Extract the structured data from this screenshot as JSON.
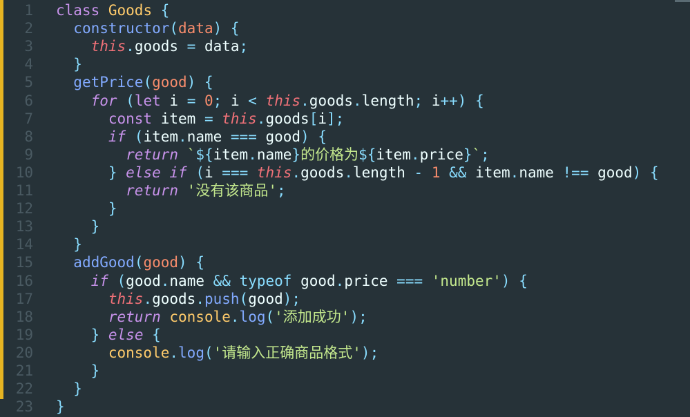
{
  "editor": {
    "colors": {
      "background": "#263238",
      "change_bar": "#e6b422",
      "line_number": "#4a5a62",
      "keyword": "#c792ea",
      "this": "#f07178",
      "class_name": "#ffcb6b",
      "function": "#82aaff",
      "parameter": "#f78c6c",
      "string": "#c3e88d",
      "operator": "#89ddff",
      "plain": "#eeffff"
    },
    "lines": [
      {
        "num": "1",
        "tokens": [
          {
            "t": "",
            "c": "sp"
          },
          {
            "t": "class",
            "c": "kw"
          },
          {
            "t": " ",
            "c": "sp"
          },
          {
            "t": "Goods",
            "c": "cls"
          },
          {
            "t": " {",
            "c": "pn"
          }
        ]
      },
      {
        "num": "2",
        "tokens": [
          {
            "t": "  ",
            "c": "sp"
          },
          {
            "t": "constructor",
            "c": "fn"
          },
          {
            "t": "(",
            "c": "pn"
          },
          {
            "t": "data",
            "c": "par"
          },
          {
            "t": ") {",
            "c": "pn"
          }
        ]
      },
      {
        "num": "3",
        "tokens": [
          {
            "t": "    ",
            "c": "sp"
          },
          {
            "t": "this",
            "c": "this"
          },
          {
            "t": ".",
            "c": "pn"
          },
          {
            "t": "goods",
            "c": "id"
          },
          {
            "t": " = ",
            "c": "op"
          },
          {
            "t": "data",
            "c": "id"
          },
          {
            "t": ";",
            "c": "pn"
          }
        ]
      },
      {
        "num": "4",
        "tokens": [
          {
            "t": "  ",
            "c": "sp"
          },
          {
            "t": "}",
            "c": "pn"
          }
        ]
      },
      {
        "num": "5",
        "tokens": [
          {
            "t": "  ",
            "c": "sp"
          },
          {
            "t": "getPrice",
            "c": "fn"
          },
          {
            "t": "(",
            "c": "pn"
          },
          {
            "t": "good",
            "c": "par"
          },
          {
            "t": ") {",
            "c": "pn"
          }
        ]
      },
      {
        "num": "6",
        "tokens": [
          {
            "t": "    ",
            "c": "sp"
          },
          {
            "t": "for",
            "c": "ctl"
          },
          {
            "t": " (",
            "c": "pn"
          },
          {
            "t": "let",
            "c": "kw"
          },
          {
            "t": " i ",
            "c": "id"
          },
          {
            "t": "=",
            "c": "op"
          },
          {
            "t": " ",
            "c": "sp"
          },
          {
            "t": "0",
            "c": "num"
          },
          {
            "t": "; ",
            "c": "pn"
          },
          {
            "t": "i ",
            "c": "id"
          },
          {
            "t": "<",
            "c": "op"
          },
          {
            "t": " ",
            "c": "sp"
          },
          {
            "t": "this",
            "c": "this"
          },
          {
            "t": ".",
            "c": "pn"
          },
          {
            "t": "goods",
            "c": "id"
          },
          {
            "t": ".",
            "c": "pn"
          },
          {
            "t": "length",
            "c": "id"
          },
          {
            "t": "; ",
            "c": "pn"
          },
          {
            "t": "i",
            "c": "id"
          },
          {
            "t": "++",
            "c": "op"
          },
          {
            "t": ") {",
            "c": "pn"
          }
        ]
      },
      {
        "num": "7",
        "tokens": [
          {
            "t": "      ",
            "c": "sp"
          },
          {
            "t": "const",
            "c": "kw"
          },
          {
            "t": " item ",
            "c": "id"
          },
          {
            "t": "=",
            "c": "op"
          },
          {
            "t": " ",
            "c": "sp"
          },
          {
            "t": "this",
            "c": "this"
          },
          {
            "t": ".",
            "c": "pn"
          },
          {
            "t": "goods",
            "c": "id"
          },
          {
            "t": "[",
            "c": "pn"
          },
          {
            "t": "i",
            "c": "id"
          },
          {
            "t": "];",
            "c": "pn"
          }
        ]
      },
      {
        "num": "8",
        "tokens": [
          {
            "t": "      ",
            "c": "sp"
          },
          {
            "t": "if",
            "c": "ctl"
          },
          {
            "t": " (",
            "c": "pn"
          },
          {
            "t": "item",
            "c": "id"
          },
          {
            "t": ".",
            "c": "pn"
          },
          {
            "t": "name ",
            "c": "id"
          },
          {
            "t": "===",
            "c": "op"
          },
          {
            "t": " good",
            "c": "id"
          },
          {
            "t": ") {",
            "c": "pn"
          }
        ]
      },
      {
        "num": "9",
        "tokens": [
          {
            "t": "        ",
            "c": "sp"
          },
          {
            "t": "return",
            "c": "ctl"
          },
          {
            "t": " ",
            "c": "sp"
          },
          {
            "t": "`",
            "c": "str"
          },
          {
            "t": "${",
            "c": "op"
          },
          {
            "t": "item",
            "c": "id"
          },
          {
            "t": ".",
            "c": "pn"
          },
          {
            "t": "name",
            "c": "id"
          },
          {
            "t": "}",
            "c": "op"
          },
          {
            "t": "的价格为",
            "c": "str"
          },
          {
            "t": "${",
            "c": "op"
          },
          {
            "t": "item",
            "c": "id"
          },
          {
            "t": ".",
            "c": "pn"
          },
          {
            "t": "price",
            "c": "id"
          },
          {
            "t": "}",
            "c": "op"
          },
          {
            "t": "`",
            "c": "str"
          },
          {
            "t": ";",
            "c": "pn"
          }
        ]
      },
      {
        "num": "10",
        "tokens": [
          {
            "t": "      ",
            "c": "sp"
          },
          {
            "t": "}",
            "c": "pn"
          },
          {
            "t": " ",
            "c": "sp"
          },
          {
            "t": "else",
            "c": "ctl"
          },
          {
            "t": " ",
            "c": "sp"
          },
          {
            "t": "if",
            "c": "ctl"
          },
          {
            "t": " (",
            "c": "pn"
          },
          {
            "t": "i ",
            "c": "id"
          },
          {
            "t": "===",
            "c": "op"
          },
          {
            "t": " ",
            "c": "sp"
          },
          {
            "t": "this",
            "c": "this"
          },
          {
            "t": ".",
            "c": "pn"
          },
          {
            "t": "goods",
            "c": "id"
          },
          {
            "t": ".",
            "c": "pn"
          },
          {
            "t": "length ",
            "c": "id"
          },
          {
            "t": "-",
            "c": "op"
          },
          {
            "t": " ",
            "c": "sp"
          },
          {
            "t": "1",
            "c": "num"
          },
          {
            "t": " ",
            "c": "sp"
          },
          {
            "t": "&&",
            "c": "op"
          },
          {
            "t": " item",
            "c": "id"
          },
          {
            "t": ".",
            "c": "pn"
          },
          {
            "t": "name ",
            "c": "id"
          },
          {
            "t": "!==",
            "c": "op"
          },
          {
            "t": " good",
            "c": "id"
          },
          {
            "t": ") {",
            "c": "pn"
          }
        ]
      },
      {
        "num": "11",
        "tokens": [
          {
            "t": "        ",
            "c": "sp"
          },
          {
            "t": "return",
            "c": "ctl"
          },
          {
            "t": " ",
            "c": "sp"
          },
          {
            "t": "'没有该商品'",
            "c": "str"
          },
          {
            "t": ";",
            "c": "pn"
          }
        ]
      },
      {
        "num": "12",
        "tokens": [
          {
            "t": "      ",
            "c": "sp"
          },
          {
            "t": "}",
            "c": "pn"
          }
        ]
      },
      {
        "num": "13",
        "tokens": [
          {
            "t": "    ",
            "c": "sp"
          },
          {
            "t": "}",
            "c": "pn"
          }
        ]
      },
      {
        "num": "14",
        "tokens": [
          {
            "t": "  ",
            "c": "sp"
          },
          {
            "t": "}",
            "c": "pn"
          }
        ]
      },
      {
        "num": "15",
        "tokens": [
          {
            "t": "  ",
            "c": "sp"
          },
          {
            "t": "addGood",
            "c": "fn"
          },
          {
            "t": "(",
            "c": "pn"
          },
          {
            "t": "good",
            "c": "par"
          },
          {
            "t": ") {",
            "c": "pn"
          }
        ]
      },
      {
        "num": "16",
        "tokens": [
          {
            "t": "    ",
            "c": "sp"
          },
          {
            "t": "if",
            "c": "ctl"
          },
          {
            "t": " (",
            "c": "pn"
          },
          {
            "t": "good",
            "c": "id"
          },
          {
            "t": ".",
            "c": "pn"
          },
          {
            "t": "name ",
            "c": "id"
          },
          {
            "t": "&&",
            "c": "op"
          },
          {
            "t": " ",
            "c": "sp"
          },
          {
            "t": "typeof",
            "c": "type"
          },
          {
            "t": " good",
            "c": "id"
          },
          {
            "t": ".",
            "c": "pn"
          },
          {
            "t": "price ",
            "c": "id"
          },
          {
            "t": "===",
            "c": "op"
          },
          {
            "t": " ",
            "c": "sp"
          },
          {
            "t": "'number'",
            "c": "str"
          },
          {
            "t": ") {",
            "c": "pn"
          }
        ]
      },
      {
        "num": "17",
        "tokens": [
          {
            "t": "      ",
            "c": "sp"
          },
          {
            "t": "this",
            "c": "this"
          },
          {
            "t": ".",
            "c": "pn"
          },
          {
            "t": "goods",
            "c": "id"
          },
          {
            "t": ".",
            "c": "pn"
          },
          {
            "t": "push",
            "c": "fn"
          },
          {
            "t": "(",
            "c": "pn"
          },
          {
            "t": "good",
            "c": "id"
          },
          {
            "t": ");",
            "c": "pn"
          }
        ]
      },
      {
        "num": "18",
        "tokens": [
          {
            "t": "      ",
            "c": "sp"
          },
          {
            "t": "return",
            "c": "ctl"
          },
          {
            "t": " ",
            "c": "sp"
          },
          {
            "t": "console",
            "c": "cons"
          },
          {
            "t": ".",
            "c": "pn"
          },
          {
            "t": "log",
            "c": "fn"
          },
          {
            "t": "(",
            "c": "pn"
          },
          {
            "t": "'添加成功'",
            "c": "str"
          },
          {
            "t": ");",
            "c": "pn"
          }
        ]
      },
      {
        "num": "19",
        "tokens": [
          {
            "t": "    ",
            "c": "sp"
          },
          {
            "t": "}",
            "c": "pn"
          },
          {
            "t": " ",
            "c": "sp"
          },
          {
            "t": "else",
            "c": "ctl"
          },
          {
            "t": " {",
            "c": "pn"
          }
        ]
      },
      {
        "num": "20",
        "tokens": [
          {
            "t": "      ",
            "c": "sp"
          },
          {
            "t": "console",
            "c": "cons"
          },
          {
            "t": ".",
            "c": "pn"
          },
          {
            "t": "log",
            "c": "fn"
          },
          {
            "t": "(",
            "c": "pn"
          },
          {
            "t": "'请输入正确商品格式'",
            "c": "str"
          },
          {
            "t": ");",
            "c": "pn"
          }
        ]
      },
      {
        "num": "21",
        "tokens": [
          {
            "t": "    ",
            "c": "sp"
          },
          {
            "t": "}",
            "c": "pn"
          }
        ]
      },
      {
        "num": "22",
        "tokens": [
          {
            "t": "  ",
            "c": "sp"
          },
          {
            "t": "}",
            "c": "pn"
          }
        ]
      },
      {
        "num": "23",
        "tokens": [
          {
            "t": "",
            "c": "sp"
          },
          {
            "t": "}",
            "c": "pn"
          }
        ]
      }
    ]
  }
}
